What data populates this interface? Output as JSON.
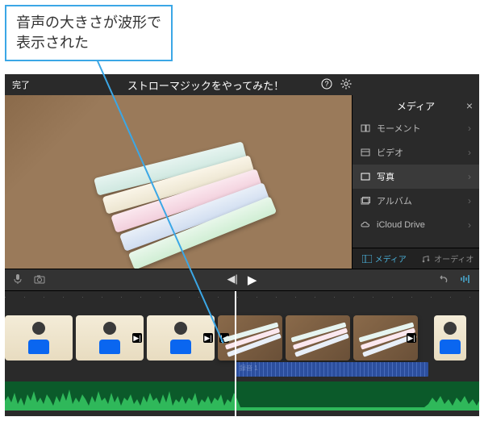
{
  "callout": {
    "line1": "音声の大きさが波形で",
    "line2": "表示された"
  },
  "topbar": {
    "done": "完了",
    "title": "ストローマジックをやってみた！"
  },
  "sidebar": {
    "header": "メディア",
    "items": [
      {
        "label": "モーメント"
      },
      {
        "label": "ビデオ"
      },
      {
        "label": "写真"
      },
      {
        "label": "アルバム"
      },
      {
        "label": "iCloud Drive"
      }
    ],
    "tabs": {
      "media": "メディア",
      "audio": "オーディオ"
    }
  },
  "timeline": {
    "audio_clip_label": "録音 1"
  }
}
